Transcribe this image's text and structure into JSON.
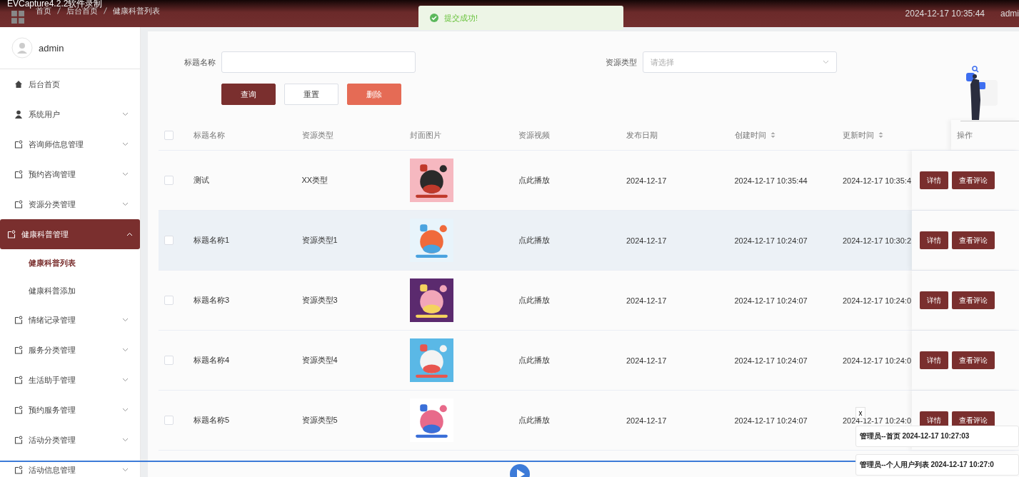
{
  "recorder_title": "EVCapture4.2.2软件录制",
  "breadcrumb": [
    "首页",
    "后台首页",
    "健康科普列表"
  ],
  "toast": {
    "message": "提交成功!"
  },
  "header": {
    "datetime": "2024-12-17 10:35:44",
    "user": "admi"
  },
  "sidebar": {
    "user": "admin",
    "items": [
      {
        "kind": "home",
        "label": "后台首页",
        "selected": false
      },
      {
        "kind": "account",
        "label": "系统用户",
        "expanded": false,
        "selected": false
      },
      {
        "kind": "menu",
        "label": "咨询师信息管理",
        "expanded": false,
        "selected": false
      },
      {
        "kind": "menu",
        "label": "预约咨询管理",
        "expanded": false,
        "selected": false
      },
      {
        "kind": "menu",
        "label": "资源分类管理",
        "expanded": false,
        "selected": false
      },
      {
        "kind": "menu",
        "label": "健康科普管理",
        "expanded": true,
        "selected": true,
        "children": [
          {
            "label": "健康科普列表",
            "selected": true
          },
          {
            "label": "健康科普添加",
            "selected": false
          }
        ]
      },
      {
        "kind": "menu",
        "label": "情绪记录管理",
        "expanded": false,
        "selected": false
      },
      {
        "kind": "menu",
        "label": "服务分类管理",
        "expanded": false,
        "selected": false
      },
      {
        "kind": "menu",
        "label": "生活助手管理",
        "expanded": false,
        "selected": false
      },
      {
        "kind": "menu",
        "label": "预约服务管理",
        "expanded": false,
        "selected": false
      },
      {
        "kind": "menu",
        "label": "活动分类管理",
        "expanded": false,
        "selected": false
      },
      {
        "kind": "menu",
        "label": "活动信息管理",
        "expanded": false,
        "selected": false
      }
    ]
  },
  "search": {
    "fields": [
      {
        "kind": "text",
        "label": "标题名称"
      },
      {
        "kind": "select",
        "label": "资源类型",
        "placeholder": "请选择"
      }
    ],
    "buttons": [
      {
        "kind": "primary",
        "label": "查询"
      },
      {
        "kind": "plain",
        "label": "重置"
      },
      {
        "kind": "danger",
        "label": "删除"
      }
    ]
  },
  "table": {
    "all_checked": false,
    "columns": [
      {
        "label": "标题名称",
        "sortable": false
      },
      {
        "label": "资源类型",
        "sortable": false
      },
      {
        "label": "封面图片",
        "sortable": false
      },
      {
        "label": "资源视频",
        "sortable": false
      },
      {
        "label": "发布日期",
        "sortable": false
      },
      {
        "label": "创建时间",
        "sortable": true
      },
      {
        "label": "更新时间",
        "sortable": true
      },
      {
        "label": "操作",
        "sortable": false
      }
    ],
    "rows": [
      {
        "checked": false,
        "hovered": false,
        "title": "测试",
        "type": "XX类型",
        "cover": {
          "kind": "picture"
        },
        "video": "点此播放",
        "date": "2024-12-17",
        "created": "2024-12-17 10:35:44",
        "updated": "2024-12-17 10:35:4",
        "actions": [
          "详情",
          "查看评论"
        ]
      },
      {
        "checked": false,
        "hovered": true,
        "title": "标题名称1",
        "type": "资源类型1",
        "cover": {
          "kind": "picture"
        },
        "video": "点此播放",
        "date": "2024-12-17",
        "created": "2024-12-17 10:24:07",
        "updated": "2024-12-17 10:30:2",
        "actions": [
          "详情",
          "查看评论"
        ]
      },
      {
        "checked": false,
        "hovered": false,
        "title": "标题名称3",
        "type": "资源类型3",
        "cover": {
          "kind": "picture"
        },
        "video": "点此播放",
        "date": "2024-12-17",
        "created": "2024-12-17 10:24:07",
        "updated": "2024-12-17 10:24:0",
        "actions": [
          "详情",
          "查看评论"
        ]
      },
      {
        "checked": false,
        "hovered": false,
        "title": "标题名称4",
        "type": "资源类型4",
        "cover": {
          "kind": "picture"
        },
        "video": "点此播放",
        "date": "2024-12-17",
        "created": "2024-12-17 10:24:07",
        "updated": "2024-12-17 10:24:0",
        "actions": [
          "详情",
          "查看评论"
        ]
      },
      {
        "checked": false,
        "hovered": false,
        "title": "标题名称5",
        "type": "资源类型5",
        "cover": {
          "kind": "picture"
        },
        "video": "点此播放",
        "date": "2024-12-17",
        "created": "2024-12-17 10:24:07",
        "updated": "2024-12-17 10:24:0",
        "actions": [
          "详情",
          "查看评论"
        ]
      }
    ]
  },
  "notifications": {
    "close": "x",
    "messages": [
      "管理员--首页 2024-12-17 10:27:03",
      "管理员--个人用户列表 2024-12-17 10:27:0"
    ]
  }
}
